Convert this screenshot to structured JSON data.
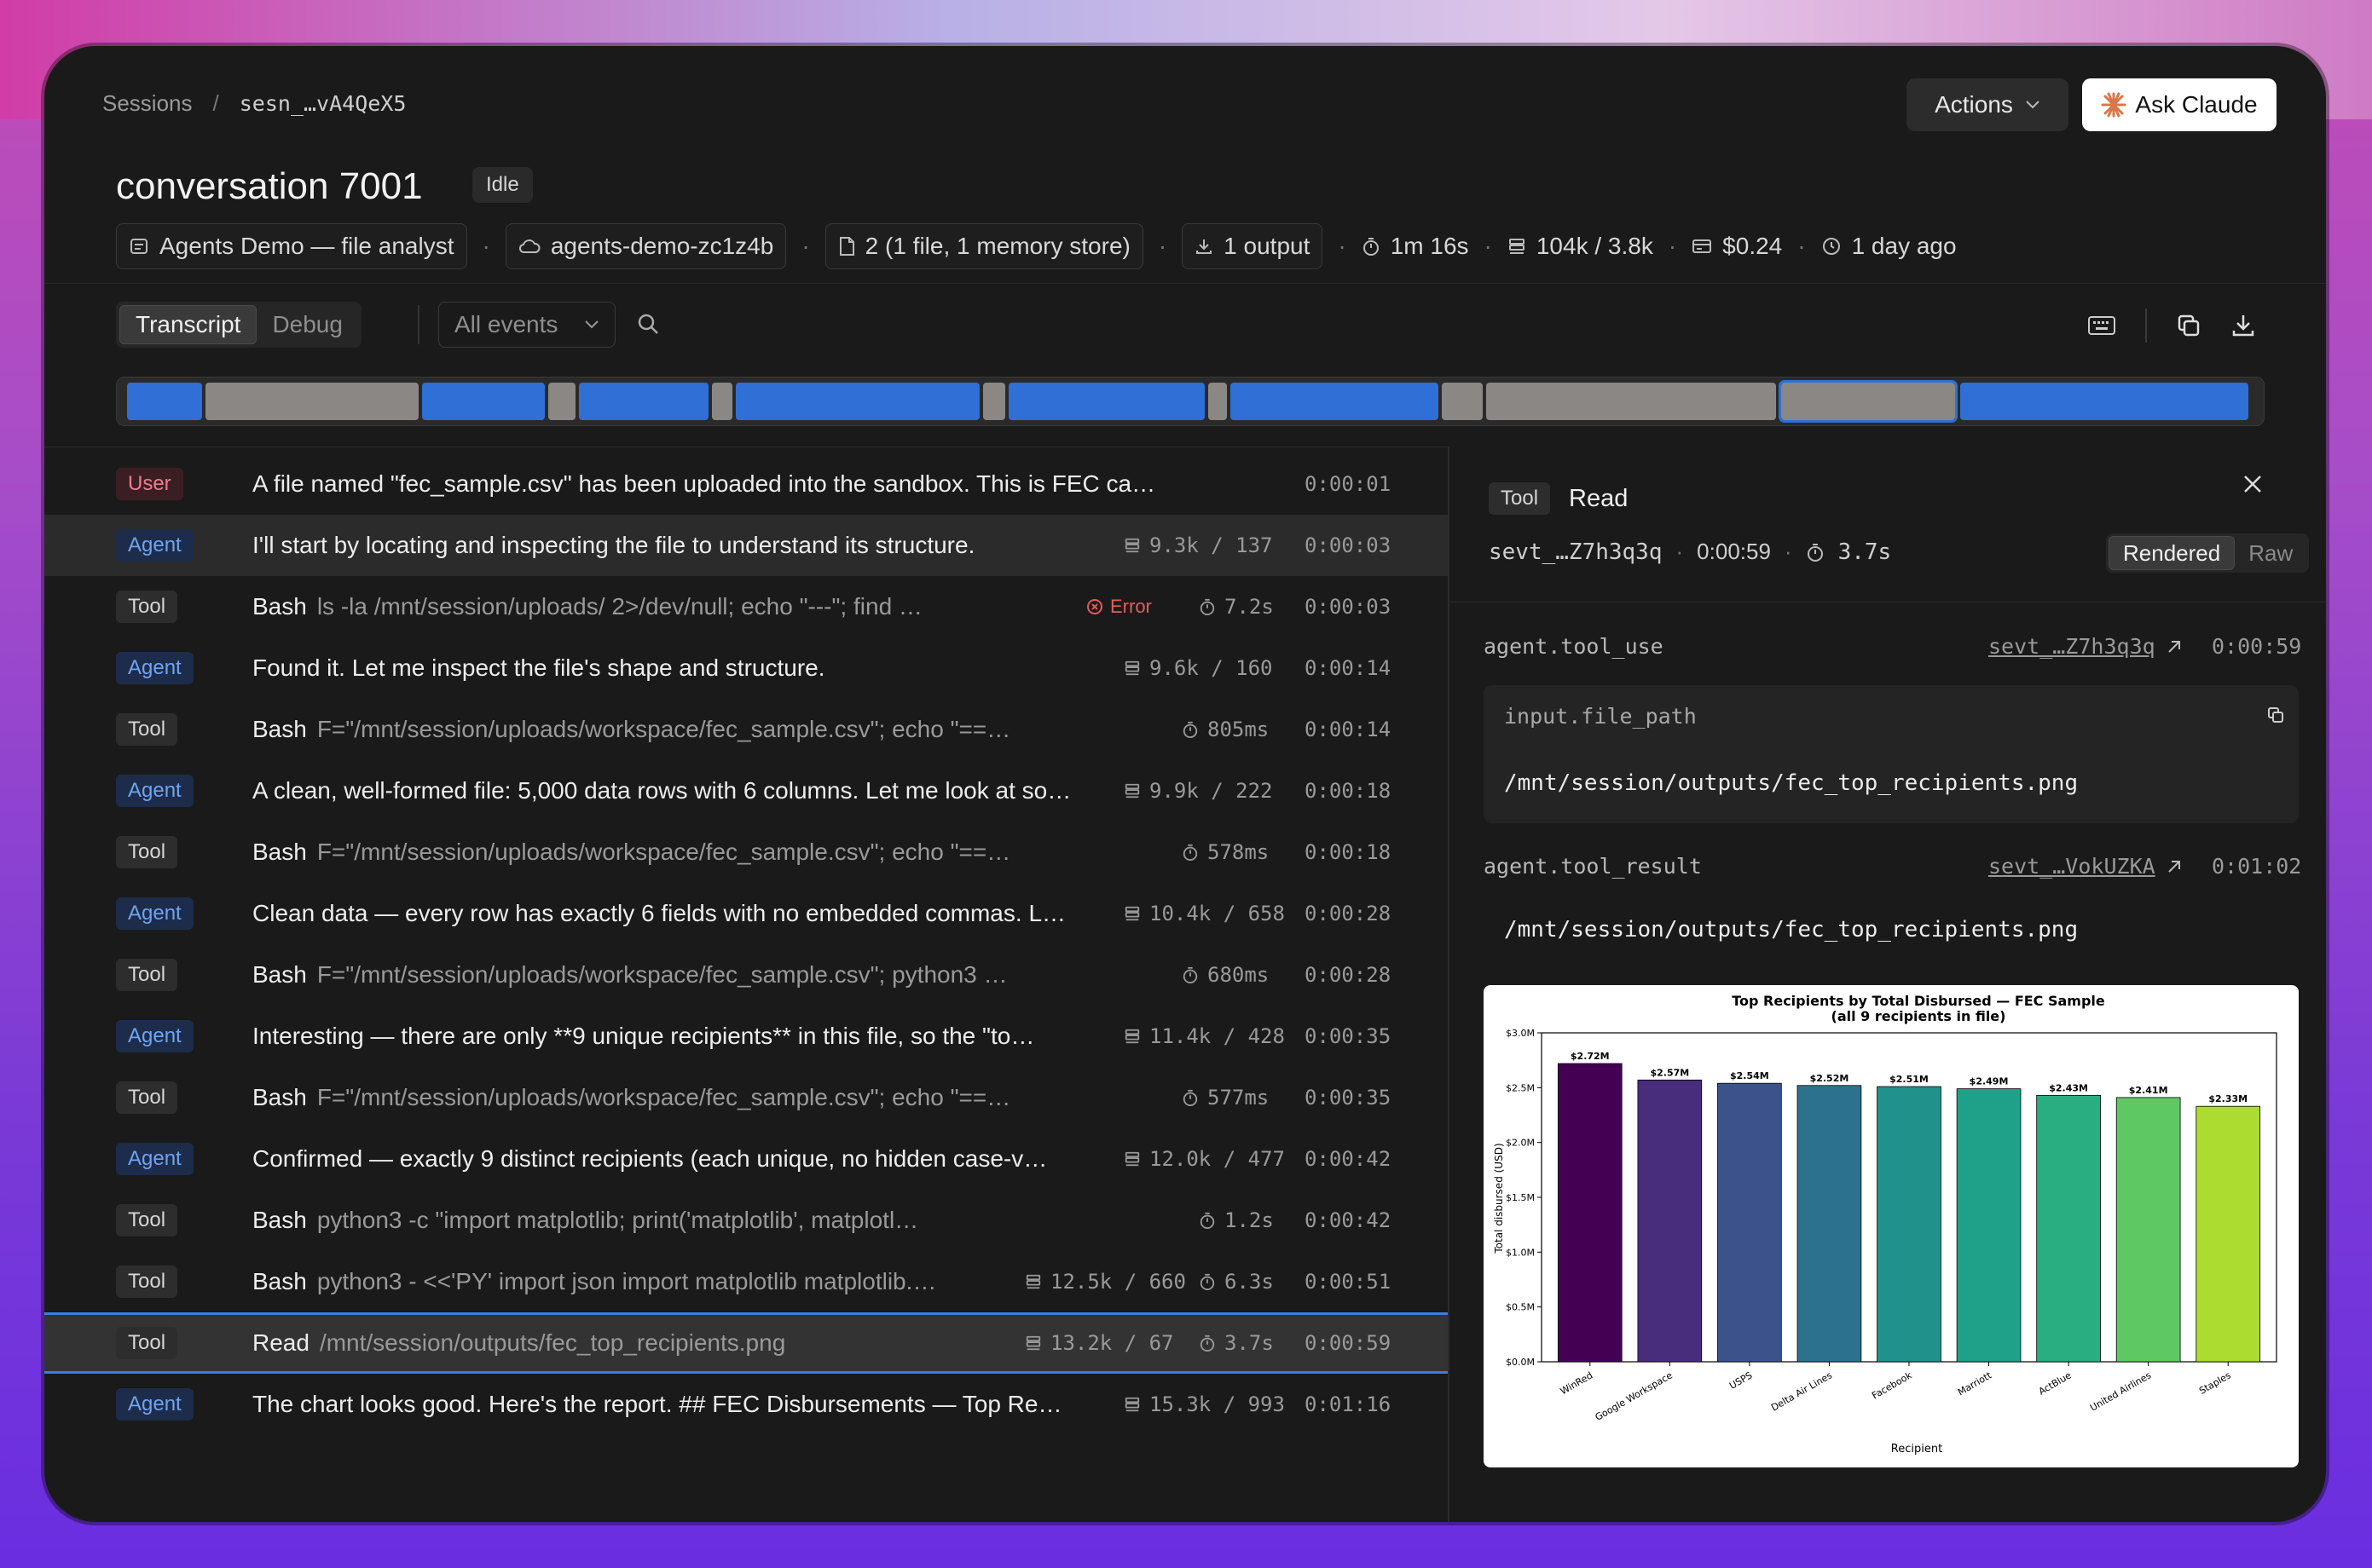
{
  "breadcrumb": {
    "root": "Sessions",
    "separator": "/",
    "session_id": "sesn_…vA4QeX5"
  },
  "header": {
    "actions_label": "Actions",
    "ask_label": "Ask Claude",
    "title": "conversation 7001",
    "status": "Idle"
  },
  "meta": {
    "agent": "Agents Demo — file analyst",
    "environment": "agents-demo-zc1z4b",
    "files": "2 (1 file, 1 memory store)",
    "outputs": "1 output",
    "duration": "1m 16s",
    "tokens": "104k / 3.8k",
    "cost": "$0.24",
    "age": "1 day ago",
    "dot": "·"
  },
  "view": {
    "transcript": "Transcript",
    "debug": "Debug",
    "filter": "All events"
  },
  "events": [
    {
      "role": "User",
      "title": "A file named \"fec_sample.csv\" has been uploaded into the sandbox. This is FEC ca…",
      "cmd": "",
      "tokens": "",
      "dur": "",
      "error": "",
      "time": "0:00:01"
    },
    {
      "role": "Agent",
      "title": "I'll start by locating and inspecting the file to understand its structure.",
      "cmd": "",
      "tokens": "9.3k / 137",
      "dur": "",
      "error": "",
      "time": "0:00:03"
    },
    {
      "role": "Tool",
      "title": "Bash",
      "cmd": "ls -la /mnt/session/uploads/ 2>/dev/null; echo \"---\"; find …",
      "tokens": "",
      "dur": "7.2s",
      "error": "Error",
      "time": "0:00:03"
    },
    {
      "role": "Agent",
      "title": "Found it. Let me inspect the file's shape and structure.",
      "cmd": "",
      "tokens": "9.6k / 160",
      "dur": "",
      "error": "",
      "time": "0:00:14"
    },
    {
      "role": "Tool",
      "title": "Bash",
      "cmd": "F=\"/mnt/session/uploads/workspace/fec_sample.csv\"; echo \"==…",
      "tokens": "",
      "dur": "805ms",
      "error": "",
      "time": "0:00:14"
    },
    {
      "role": "Agent",
      "title": "A clean, well-formed file: 5,000 data rows with 6 columns. Let me look at so…",
      "cmd": "",
      "tokens": "9.9k / 222",
      "dur": "",
      "error": "",
      "time": "0:00:18"
    },
    {
      "role": "Tool",
      "title": "Bash",
      "cmd": "F=\"/mnt/session/uploads/workspace/fec_sample.csv\"; echo \"==…",
      "tokens": "",
      "dur": "578ms",
      "error": "",
      "time": "0:00:18"
    },
    {
      "role": "Agent",
      "title": "Clean data — every row has exactly 6 fields with no embedded commas. L…",
      "cmd": "",
      "tokens": "10.4k / 658",
      "dur": "",
      "error": "",
      "time": "0:00:28"
    },
    {
      "role": "Tool",
      "title": "Bash",
      "cmd": "F=\"/mnt/session/uploads/workspace/fec_sample.csv\"; python3 …",
      "tokens": "",
      "dur": "680ms",
      "error": "",
      "time": "0:00:28"
    },
    {
      "role": "Agent",
      "title": "Interesting — there are only **9 unique recipients** in this file, so the \"to…",
      "cmd": "",
      "tokens": "11.4k / 428",
      "dur": "",
      "error": "",
      "time": "0:00:35"
    },
    {
      "role": "Tool",
      "title": "Bash",
      "cmd": "F=\"/mnt/session/uploads/workspace/fec_sample.csv\"; echo \"==…",
      "tokens": "",
      "dur": "577ms",
      "error": "",
      "time": "0:00:35"
    },
    {
      "role": "Agent",
      "title": "Confirmed — exactly 9 distinct recipients (each unique, no hidden case-v…",
      "cmd": "",
      "tokens": "12.0k / 477",
      "dur": "",
      "error": "",
      "time": "0:00:42"
    },
    {
      "role": "Tool",
      "title": "Bash",
      "cmd": "python3 -c \"import matplotlib; print('matplotlib', matplotl…",
      "tokens": "",
      "dur": "1.2s",
      "error": "",
      "time": "0:00:42"
    },
    {
      "role": "Tool",
      "title": "Bash",
      "cmd": "python3 - <<'PY' import json import matplotlib matplotlib.…",
      "tokens": "12.5k / 660",
      "dur": "6.3s",
      "error": "",
      "time": "0:00:51"
    },
    {
      "role": "Tool",
      "title": "Read",
      "cmd": "/mnt/session/outputs/fec_top_recipients.png",
      "tokens": "13.2k / 67",
      "dur": "3.7s",
      "error": "",
      "time": "0:00:59"
    },
    {
      "role": "Agent",
      "title": "The chart looks good. Here's the report. ## FEC Disbursements — Top Re…",
      "cmd": "",
      "tokens": "15.3k / 993",
      "dur": "",
      "error": "",
      "time": "0:01:16"
    }
  ],
  "detail": {
    "badge": "Tool",
    "name": "Read",
    "event_id": "sevt_…Z7h3q3q",
    "time": "0:00:59",
    "duration": "3.7s",
    "rendered": "Rendered",
    "raw": "Raw",
    "tool_use_label": "agent.tool_use",
    "tool_use_id": "sevt_…Z7h3q3q",
    "tool_use_time": "0:00:59",
    "input_key": "input.file_path",
    "input_value": "/mnt/session/outputs/fec_top_recipients.png",
    "tool_result_label": "agent.tool_result",
    "tool_result_id": "sevt_…VokUZKA",
    "tool_result_time": "0:01:02",
    "result_value": "/mnt/session/outputs/fec_top_recipients.png"
  },
  "colors": {
    "accent": "#2f6fd6",
    "error": "#e25c5c",
    "agent": "#6fa4f0",
    "user": "#ee7d8e"
  },
  "chart_data": {
    "type": "bar",
    "title": "Top Recipients by Total Disbursed — FEC Sample",
    "subtitle": "(all 9 recipients in file)",
    "xlabel": "Recipient",
    "ylabel": "Total disbursed (USD)",
    "ylim": [
      0,
      3.0
    ],
    "yticks": [
      "$0.0M",
      "$0.5M",
      "$1.0M",
      "$1.5M",
      "$2.0M",
      "$2.5M",
      "$3.0M"
    ],
    "categories": [
      "WinRed",
      "Google Workspace",
      "USPS",
      "Delta Air Lines",
      "Facebook",
      "Marriott",
      "ActBlue",
      "United Airlines",
      "Staples"
    ],
    "values": [
      2.72,
      2.57,
      2.54,
      2.52,
      2.51,
      2.49,
      2.43,
      2.41,
      2.33
    ],
    "labels": [
      "$2.72M",
      "$2.57M",
      "$2.54M",
      "$2.52M",
      "$2.51M",
      "$2.49M",
      "$2.43M",
      "$2.41M",
      "$2.33M"
    ],
    "bar_colors": [
      "#440154",
      "#472d7b",
      "#3b528b",
      "#2c728e",
      "#21918c",
      "#1fa088",
      "#28ae80",
      "#5ec962",
      "#addc30"
    ],
    "grid": false,
    "legend": "none"
  }
}
